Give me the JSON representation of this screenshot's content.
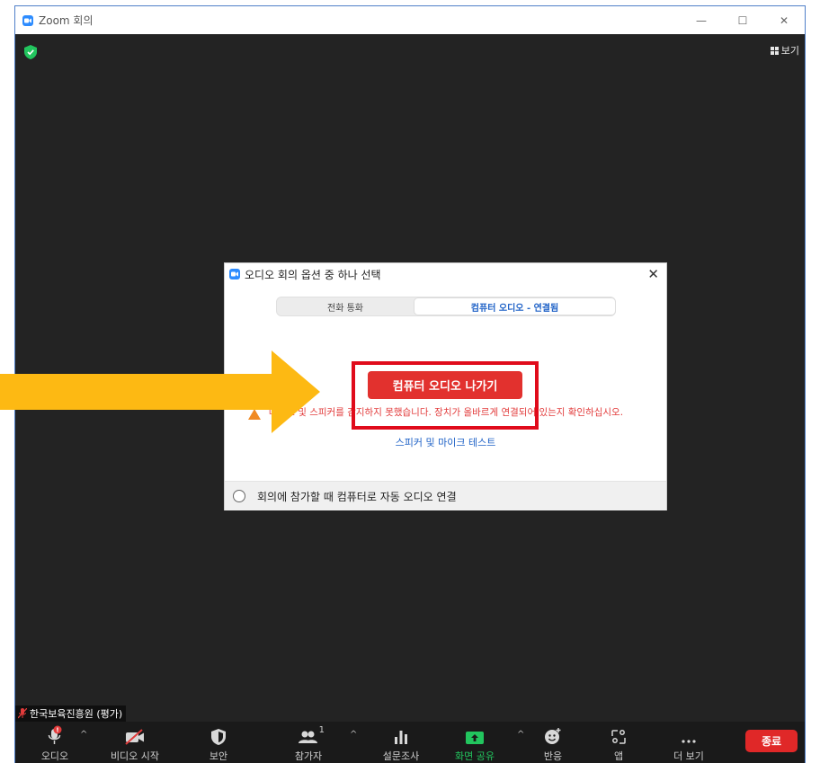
{
  "window": {
    "title": "Zoom 회의",
    "controls": {
      "minimize": "—",
      "maximize": "☐",
      "close": "✕"
    }
  },
  "meeting": {
    "view_label": "보기",
    "participant_name": "한국보육진흥원 (평가)"
  },
  "toolbar": {
    "audio": "오디오",
    "video": "비디오 시작",
    "security": "보안",
    "participants": "참가자",
    "participants_count": "1",
    "polls": "설문조사",
    "share": "화면 공유",
    "reactions": "반응",
    "apps": "앱",
    "more": "더 보기",
    "end": "종료",
    "caret": "^"
  },
  "dialog": {
    "title": "오디오 회의 옵션 중 하나 선택",
    "close": "✕",
    "tabs": [
      {
        "label": "전화 통화"
      },
      {
        "label": "컴퓨터 오디오 - 연결됨"
      }
    ],
    "leave_button": "컴퓨터 오디오 나가기",
    "warning": "마이크 및 스피커를 감지하지 못했습니다. 장치가 올바르게 연결되어 있는지 확인하십시오.",
    "test_link": "스피커 및 마이크 테스트",
    "auto_connect_label": "회의에 참가할 때 컴퓨터로 자동 오디오 연결"
  },
  "colors": {
    "accent_blue": "#2d8cff",
    "end_red": "#e02828",
    "highlight_red": "#e00b1b",
    "arrow_yellow": "#fdb913",
    "share_green": "#22c55e"
  }
}
